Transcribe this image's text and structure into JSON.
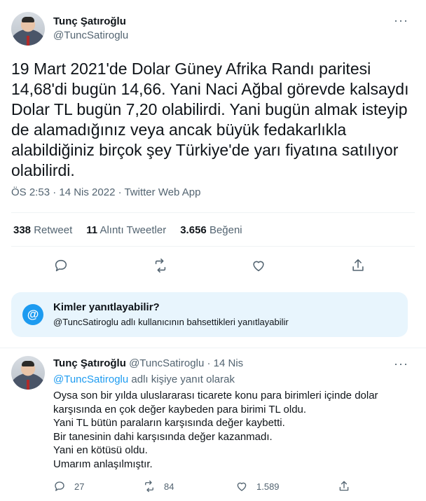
{
  "tweet": {
    "author_name": "Tunç Şatıroğlu",
    "author_handle": "@TuncSatiroglu",
    "text": "19 Mart 2021'de Dolar Güney Afrika Randı paritesi 14,68'di bugün 14,66. Yani Naci Ağbal görevde kalsaydı Dolar TL bugün 7,20 olabilirdi. Yani bugün almak isteyip de alamadığınız veya ancak büyük fedakarlıkla alabildiğiniz birçok şey Türkiye'de yarı fiyatına satılıyor olabilirdi.",
    "meta": "ÖS 2:53 · 14 Nis 2022 · Twitter Web App",
    "stats": {
      "retweets_count": "338",
      "retweets_label": "Retweet",
      "quotes_count": "11",
      "quotes_label": "Alıntı Tweetler",
      "likes_count": "3.656",
      "likes_label": "Beğeni"
    },
    "icons": [
      "reply-icon",
      "retweet-icon",
      "like-icon",
      "share-icon",
      "more-icon"
    ]
  },
  "reply_restriction": {
    "title": "Kimler yanıtlayabilir?",
    "subtitle": "@TuncSatiroglu adlı kullanıcının bahsettikleri yanıtlayabilir",
    "icon_glyph": "@"
  },
  "reply": {
    "author_name": "Tunç Şatıroğlu",
    "author_handle": "@TuncSatiroglu",
    "dot": "·",
    "date": "14 Nis",
    "replying_to_handle": "@TuncSatiroglu",
    "replying_to_suffix": "adlı kişiye yanıt olarak",
    "lines": [
      "Oysa son bir yılda uluslararası ticarete konu para birimleri içinde dolar",
      "karşısında en çok değer kaybeden para birimi TL oldu.",
      "Yani TL bütün paraların karşısında değer kaybetti.",
      "Bir tanesinin dahi karşısında değer kazanmadı.",
      "Yani en kötüsü oldu.",
      "Umarım anlaşılmıştır."
    ],
    "replies_count": "27",
    "retweets_count": "84",
    "likes_count": "1.589"
  },
  "colors": {
    "accent": "#1d9bf0",
    "text_primary": "#0f1419",
    "text_secondary": "#536471",
    "reply_box_bg": "#e8f5fd"
  }
}
